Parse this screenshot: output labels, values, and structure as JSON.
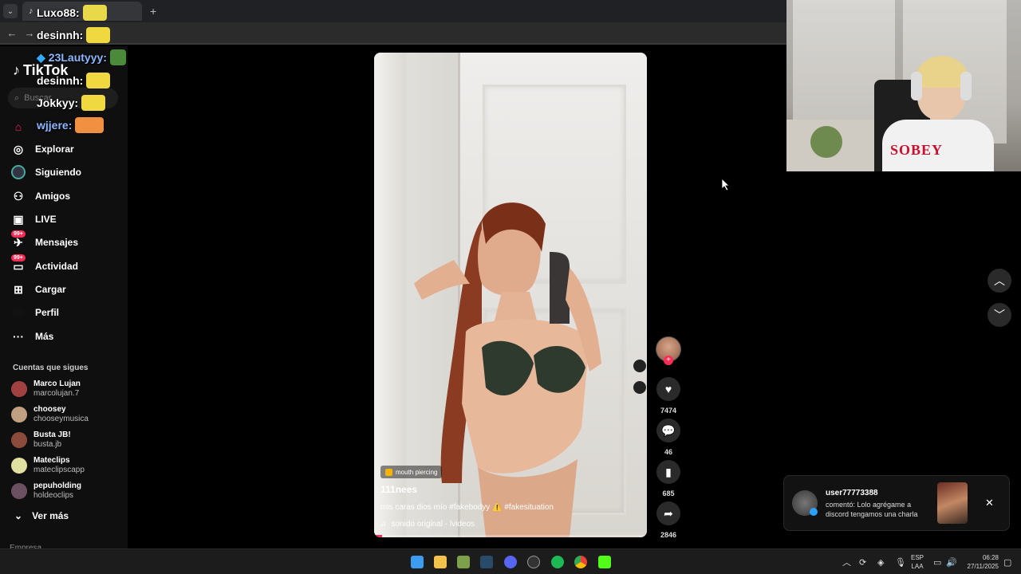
{
  "browser": {
    "back_icon": "arrow-left",
    "forward_icon": "arrow-right",
    "new_tab": "+"
  },
  "chat": [
    {
      "user": "Luxo88:"
    },
    {
      "user": "desinnh:"
    },
    {
      "user": "23Lautyyy:"
    },
    {
      "user": "desinnh:"
    },
    {
      "user": "Jokkyy:"
    },
    {
      "user": "wjjere:"
    }
  ],
  "sidebar": {
    "logo": "TikTok",
    "search_placeholder": "Buscar",
    "items": [
      {
        "label": "",
        "icon": "home-icon"
      },
      {
        "label": "Explorar",
        "icon": "compass-icon"
      },
      {
        "label": "Siguiendo",
        "icon": "following-icon"
      },
      {
        "label": "Amigos",
        "icon": "friends-icon"
      },
      {
        "label": "LIVE",
        "icon": "live-icon"
      },
      {
        "label": "Mensajes",
        "icon": "messages-icon",
        "badge": "99+"
      },
      {
        "label": "Actividad",
        "icon": "activity-icon",
        "badge": "99+"
      },
      {
        "label": "Cargar",
        "icon": "upload-icon"
      },
      {
        "label": "Perfil",
        "icon": "profile-icon"
      },
      {
        "label": "Más",
        "icon": "more-icon"
      }
    ],
    "following_title": "Cuentas que sigues",
    "following": [
      {
        "name": "Marco Lujan",
        "handle": "marcolujan.7",
        "color": "#a04040"
      },
      {
        "name": "choosey",
        "handle": "chooseymusica",
        "color": "#c0a080"
      },
      {
        "name": "Busta JB!",
        "handle": "busta.jb",
        "color": "#8b4a3a"
      },
      {
        "name": "Mateclips",
        "handle": "mateclipscapp",
        "color": "#e0e0a0"
      },
      {
        "name": "pepuholding",
        "handle": "holdeoclips",
        "color": "#6a5060"
      }
    ],
    "see_more": "Ver más",
    "cut_text": "Empresa"
  },
  "video": {
    "tag": "mouth piercing",
    "author": "111nees",
    "caption": "mis caras dios mío #fakebodyy ⚠️ #fakesituation",
    "sound": "sonido original - lvideos",
    "progress": 0.03
  },
  "actions": {
    "likes": "7474",
    "comments": "46",
    "saves": "685",
    "shares": "2846"
  },
  "notification": {
    "user": "user77773388",
    "message": "comentó: Lolo agrégame a discord tengamos una charla"
  },
  "webcam": {
    "shirt_text": "SOBEY"
  },
  "taskbar": {
    "lang_top": "ESP",
    "lang_bottom": "LAA",
    "time": "06:28",
    "date": "27/11/2025"
  }
}
